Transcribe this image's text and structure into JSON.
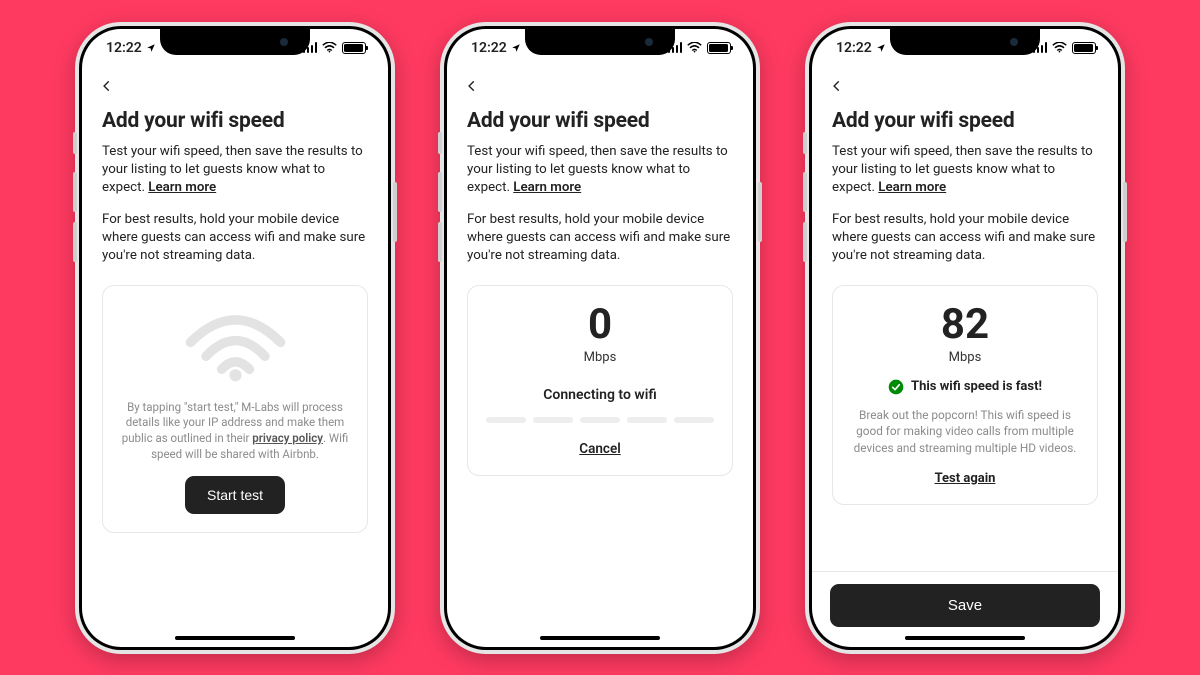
{
  "status": {
    "time": "12:22"
  },
  "header": {
    "title": "Add your wifi speed"
  },
  "intro": {
    "p1_a": "Test your wifi speed, then save the results to your listing to let guests know what to expect.  ",
    "learn_more": "Learn more",
    "p2": "For best results, hold your mobile device where guests can access wifi and make sure you're not streaming data."
  },
  "screen1": {
    "disclaimer_a": "By tapping \"start test,\" M-Labs will process details like your IP address and make them public as outlined in their ",
    "privacy_link": "privacy policy",
    "disclaimer_b": ". Wifi speed will be shared with Airbnb.",
    "start_label": "Start test"
  },
  "screen2": {
    "value": "0",
    "unit": "Mbps",
    "status": "Connecting to wifi",
    "cancel_label": "Cancel"
  },
  "screen3": {
    "value": "82",
    "unit": "Mbps",
    "badge_text": "This wifi speed is fast!",
    "badge_color": "#008a05",
    "description": "Break out the popcorn! This wifi speed is good for making video calls from multiple devices and streaming multiple HD videos.",
    "test_again_label": "Test again",
    "save_label": "Save"
  }
}
